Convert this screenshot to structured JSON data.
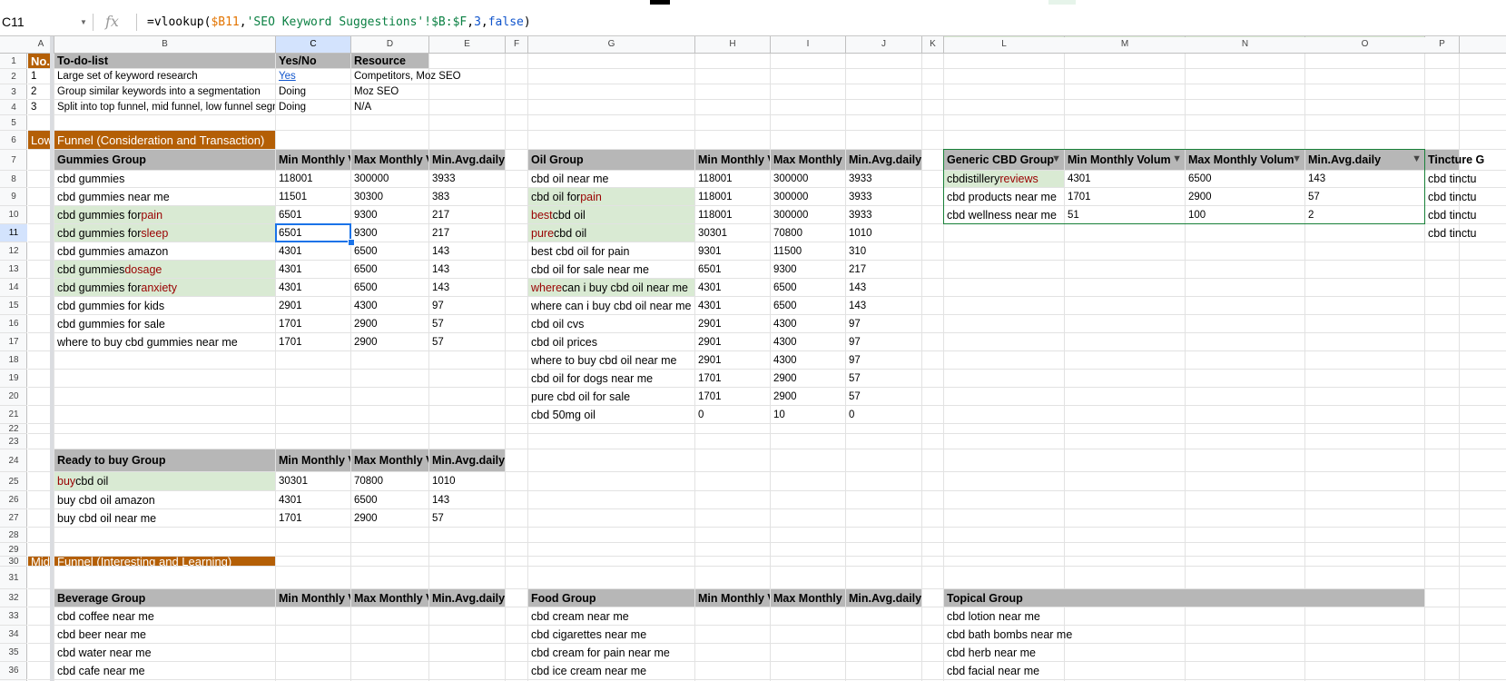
{
  "name_box": "C11",
  "formula_bar": {
    "fx_label": "fx",
    "prefix": "=vlookup(",
    "ref1": "$B11",
    "sep1": ",",
    "sheet_ref": "'SEO Keyword Suggestions'!$B:$F",
    "sep2": ",",
    "num": "3",
    "sep3": ",",
    "bool": "false",
    "suffix": ")"
  },
  "columns": [
    "A",
    "B",
    "C",
    "D",
    "E",
    "F",
    "G",
    "H",
    "I",
    "J",
    "K",
    "L",
    "M",
    "N",
    "O",
    "P"
  ],
  "rows": [
    "1",
    "2",
    "3",
    "4",
    "5",
    "6",
    "7",
    "8",
    "9",
    "10",
    "11",
    "12",
    "13",
    "14",
    "15",
    "16",
    "17",
    "18",
    "19",
    "20",
    "21",
    "22",
    "23",
    "24",
    "25",
    "26",
    "27",
    "28",
    "29",
    "30",
    "31",
    "32",
    "33",
    "34",
    "35",
    "36"
  ],
  "todo": {
    "h_no": "No.",
    "h_list": "To-do-list",
    "h_yes": "Yes/No",
    "h_res": "Resource",
    "rows": [
      {
        "no": "1",
        "task": "Large set of keyword research",
        "status": "Yes",
        "res": "Competitors, Moz SEO"
      },
      {
        "no": "2",
        "task": "Group similar keywords into a segmentation",
        "status": "Doing",
        "res": "Moz SEO"
      },
      {
        "no": "3",
        "task": "Split into top funnel, mid funnel, low funnel segme",
        "status": "Doing",
        "res": "N/A"
      }
    ]
  },
  "sections": {
    "low_a": "Low",
    "low_b": "Funnel (Consideration and Transaction)",
    "mid_a": "Mid F",
    "mid_b": "Funnel (Interesting and Learning)"
  },
  "headers": {
    "gummies": "Gummies Group",
    "oil": "Oil Group",
    "generic": "Generic CBD Group",
    "tincture": "Tincture G",
    "ready": "Ready to buy Group",
    "beverage": "Beverage Group",
    "food": "Food Group",
    "topical": "Topical Group",
    "min_v": "Min Monthly V",
    "max_v": "Max Monthly V",
    "min_ad": "Min.Avg.daily",
    "min_v_oil": "Min Monthly V",
    "max_v_oil": "Max Monthly \\",
    "min_v_gen": "Min Monthly Volum",
    "max_v_gen": "Max Monthly Volum",
    "max_v_food": "Max Monthly \\"
  },
  "gummies": [
    {
      "a": "cbd gummies",
      "r": "",
      "min": "118001",
      "max": "300000",
      "d": "3933"
    },
    {
      "a": "cbd gummies near me",
      "r": "",
      "min": "11501",
      "max": "30300",
      "d": "383"
    },
    {
      "a": "cbd gummies for ",
      "r": "pain",
      "min": "6501",
      "max": "9300",
      "d": "217"
    },
    {
      "a": "cbd gummies for ",
      "r": "sleep",
      "min": "6501",
      "max": "9300",
      "d": "217"
    },
    {
      "a": "cbd gummies amazon",
      "r": "",
      "min": "4301",
      "max": "6500",
      "d": "143"
    },
    {
      "a": "cbd gummies ",
      "r": "dosage",
      "min": "4301",
      "max": "6500",
      "d": "143"
    },
    {
      "a": "cbd gummies for ",
      "r": "anxiety",
      "min": "4301",
      "max": "6500",
      "d": "143"
    },
    {
      "a": "cbd gummies for kids",
      "r": "",
      "min": "2901",
      "max": "4300",
      "d": "97"
    },
    {
      "a": "cbd gummies for sale",
      "r": "",
      "min": "1701",
      "max": "2900",
      "d": "57"
    },
    {
      "a": "where to buy cbd gummies near me",
      "r": "",
      "min": "1701",
      "max": "2900",
      "d": "57"
    }
  ],
  "oil": [
    {
      "pre": "",
      "red": "",
      "post": "cbd oil near me",
      "min": "118001",
      "max": "300000",
      "d": "3933"
    },
    {
      "pre": "cbd oil for ",
      "red": "pain",
      "post": "",
      "min": "118001",
      "max": "300000",
      "d": "3933"
    },
    {
      "pre": "",
      "red": "best",
      "post": " cbd oil",
      "min": "118001",
      "max": "300000",
      "d": "3933"
    },
    {
      "pre": "",
      "red": "pure",
      "post": " cbd oil",
      "min": "30301",
      "max": "70800",
      "d": "1010"
    },
    {
      "pre": "",
      "red": "",
      "post": "best cbd oil for pain",
      "min": "9301",
      "max": "11500",
      "d": "310"
    },
    {
      "pre": "",
      "red": "",
      "post": "cbd oil for sale near me",
      "min": "6501",
      "max": "9300",
      "d": "217"
    },
    {
      "pre": "",
      "red": "where",
      "post": " can i buy cbd oil near me",
      "min": "4301",
      "max": "6500",
      "d": "143"
    },
    {
      "pre": "",
      "red": "",
      "post": "where can i buy cbd oil near me",
      "min": "4301",
      "max": "6500",
      "d": "143"
    },
    {
      "pre": "",
      "red": "",
      "post": "cbd oil cvs",
      "min": "2901",
      "max": "4300",
      "d": "97"
    },
    {
      "pre": "",
      "red": "",
      "post": "cbd oil prices",
      "min": "2901",
      "max": "4300",
      "d": "97"
    },
    {
      "pre": "",
      "red": "",
      "post": "where to buy cbd oil near me",
      "min": "2901",
      "max": "4300",
      "d": "97"
    },
    {
      "pre": "",
      "red": "",
      "post": "cbd oil for dogs near me",
      "min": "1701",
      "max": "2900",
      "d": "57"
    },
    {
      "pre": "",
      "red": "",
      "post": "pure cbd oil for sale",
      "min": "1701",
      "max": "2900",
      "d": "57"
    },
    {
      "pre": "",
      "red": "",
      "post": "cbd 50mg oil",
      "min": "0",
      "max": "10",
      "d": "0"
    }
  ],
  "generic": [
    {
      "pre": "cbdistillery ",
      "red": "reviews",
      "min": "4301",
      "max": "6500",
      "d": "143"
    },
    {
      "pre": "cbd products near me",
      "red": "",
      "min": "1701",
      "max": "2900",
      "d": "57"
    },
    {
      "pre": "cbd wellness near me",
      "red": "",
      "min": "51",
      "max": "100",
      "d": "2"
    }
  ],
  "tincture": [
    "cbd tinctu",
    "cbd tinctu",
    "cbd tinctu",
    "cbd tinctu"
  ],
  "ready": [
    {
      "red": "buy",
      "post": " cbd oil",
      "min": "30301",
      "max": "70800",
      "d": "1010"
    },
    {
      "red": "",
      "post": "buy cbd oil amazon",
      "min": "4301",
      "max": "6500",
      "d": "143"
    },
    {
      "red": "",
      "post": "buy cbd oil near me",
      "min": "1701",
      "max": "2900",
      "d": "57"
    }
  ],
  "beverage": [
    "cbd coffee near me",
    "cbd beer near me",
    "cbd water near me",
    "cbd cafe near me"
  ],
  "food": [
    "cbd cream near me",
    "cbd cigarettes near me",
    "cbd cream for pain near me",
    "cbd ice cream near me"
  ],
  "topical": [
    "cbd lotion near me",
    "cbd bath bombs near me",
    "cbd herb near me",
    "cbd facial near me"
  ]
}
